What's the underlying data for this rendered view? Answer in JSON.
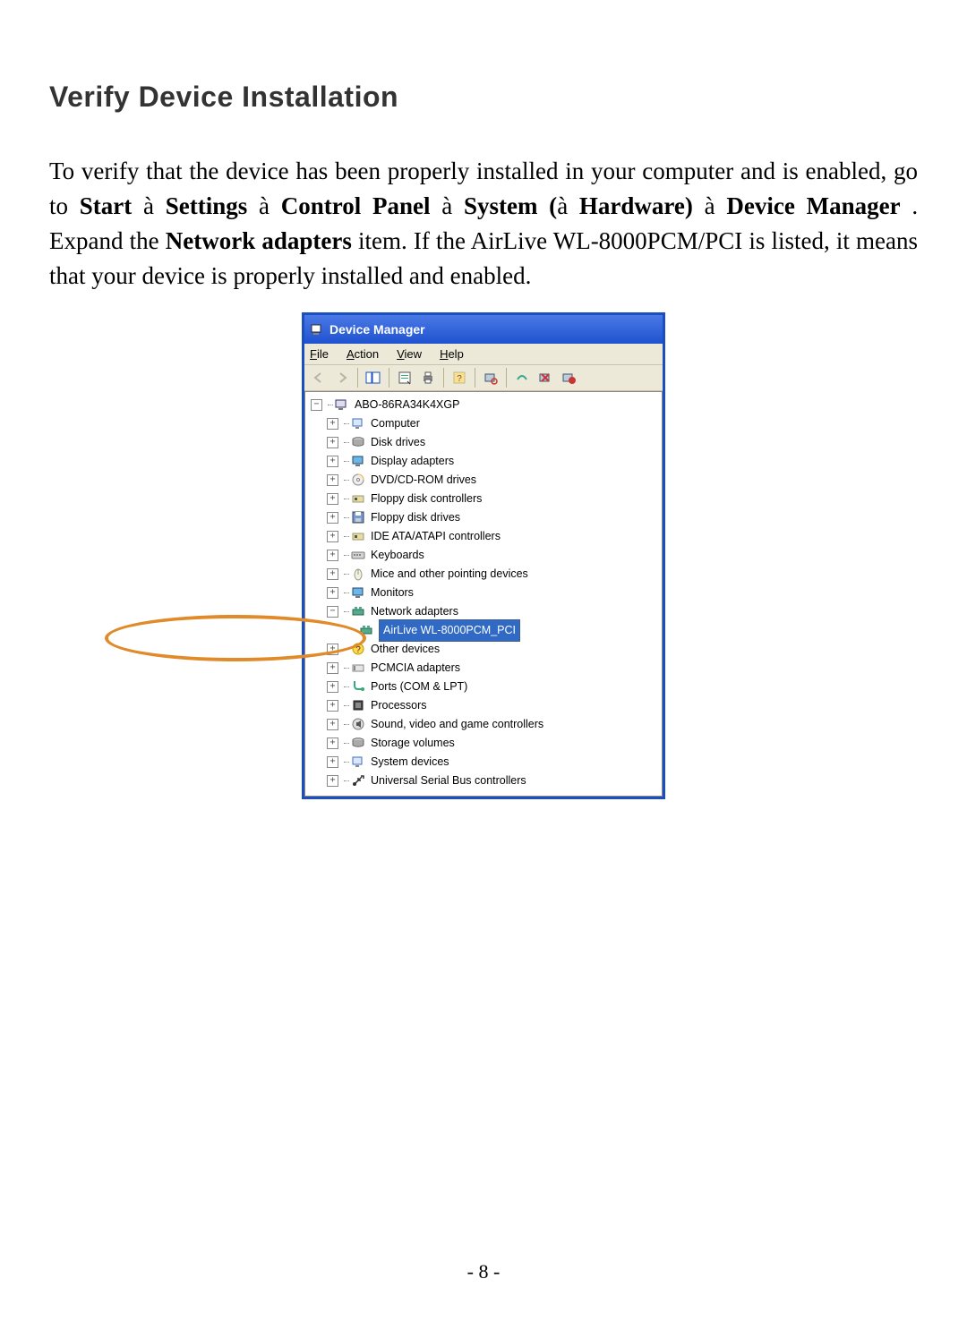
{
  "page": {
    "heading": "Verify Device Installation",
    "intro": "To verify that the device has been properly installed in your computer and is enabled, go to ",
    "path_parts": [
      "Start",
      " à ",
      "Settings",
      " à ",
      "Control Panel",
      " à ",
      "System (",
      "à ",
      "Hardware)",
      " à ",
      "Device Manager"
    ],
    "after_path": ". Expand the ",
    "bold_item": "Network adapters",
    "after_bold": " item. If the AirLive WL-8000PCM/PCI is listed, it means that your device is properly installed and enabled.",
    "page_number": "- 8 -"
  },
  "dm": {
    "title": "Device Manager",
    "menu": {
      "file": "File",
      "action": "Action",
      "view": "View",
      "help": "Help"
    },
    "tree": {
      "root": "ABO-86RA34K4XGP",
      "items": [
        {
          "label": "Computer",
          "expanded": false,
          "icon": "computer"
        },
        {
          "label": "Disk drives",
          "expanded": false,
          "icon": "disk"
        },
        {
          "label": "Display adapters",
          "expanded": false,
          "icon": "display"
        },
        {
          "label": "DVD/CD-ROM drives",
          "expanded": false,
          "icon": "cd"
        },
        {
          "label": "Floppy disk controllers",
          "expanded": false,
          "icon": "controller"
        },
        {
          "label": "Floppy disk drives",
          "expanded": false,
          "icon": "floppy"
        },
        {
          "label": "IDE ATA/ATAPI controllers",
          "expanded": false,
          "icon": "controller"
        },
        {
          "label": "Keyboards",
          "expanded": false,
          "icon": "keyboard"
        },
        {
          "label": "Mice and other pointing devices",
          "expanded": false,
          "icon": "mouse"
        },
        {
          "label": "Monitors",
          "expanded": false,
          "icon": "display"
        },
        {
          "label": "Network adapters",
          "expanded": true,
          "icon": "network"
        },
        {
          "label": "Other devices",
          "expanded": false,
          "icon": "other"
        },
        {
          "label": "PCMCIA adapters",
          "expanded": false,
          "icon": "pcmcia"
        },
        {
          "label": "Ports (COM & LPT)",
          "expanded": false,
          "icon": "port"
        },
        {
          "label": "Processors",
          "expanded": false,
          "icon": "cpu"
        },
        {
          "label": "Sound, video and game controllers",
          "expanded": false,
          "icon": "sound"
        },
        {
          "label": "Storage volumes",
          "expanded": false,
          "icon": "disk"
        },
        {
          "label": "System devices",
          "expanded": false,
          "icon": "computer"
        },
        {
          "label": "Universal Serial Bus controllers",
          "expanded": false,
          "icon": "usb"
        }
      ],
      "selected_child": "AirLive WL-8000PCM_PCI"
    }
  }
}
